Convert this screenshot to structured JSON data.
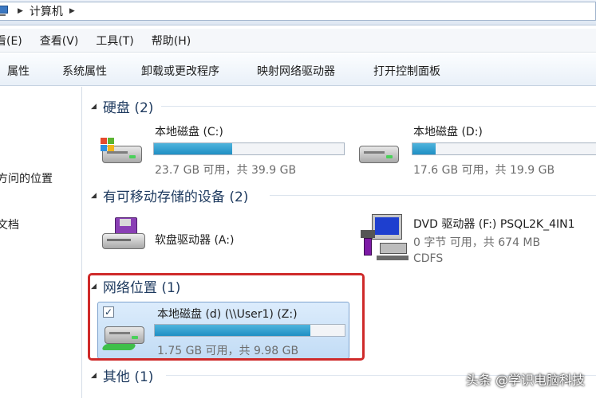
{
  "address": {
    "breadcrumb": "计算机"
  },
  "menu": [
    "看(E)",
    "查看(V)",
    "工具(T)",
    "帮助(H)"
  ],
  "toolbar": [
    "属性",
    "系统属性",
    "卸载或更改程序",
    "映射网络驱动器",
    "打开控制面板"
  ],
  "nav": {
    "item1": "方问的位置",
    "item2": "文档"
  },
  "groups": {
    "hdd": "硬盘 (2)",
    "removable": "有可移动存储的设备 (2)",
    "network": "网络位置 (1)",
    "other": "其他 (1)"
  },
  "drives": {
    "c": {
      "name": "本地磁盘 (C:)",
      "info": "23.7 GB 可用，共 39.9 GB",
      "used_fraction": 0.41
    },
    "d": {
      "name": "本地磁盘 (D:)",
      "info": "17.6 GB 可用，共 19.9 GB",
      "used_fraction": 0.12
    },
    "a": {
      "name": "软盘驱动器 (A:)"
    },
    "f": {
      "name": "DVD 驱动器 (F:) PSQL2K_4IN1",
      "info": "0 字节 可用，共 674 MB",
      "fs": "CDFS"
    },
    "z": {
      "name": "本地磁盘 (d) (\\\\User1) (Z:)",
      "info": "1.75 GB 可用，共 9.98 GB",
      "used_fraction": 0.82,
      "checked": "✓"
    }
  },
  "watermark": "头条 @学识电脑科技",
  "colors": {
    "bar_fill": "#1f8fc4",
    "highlight": "#cf2a2a",
    "selection": "#c2dcf5"
  }
}
